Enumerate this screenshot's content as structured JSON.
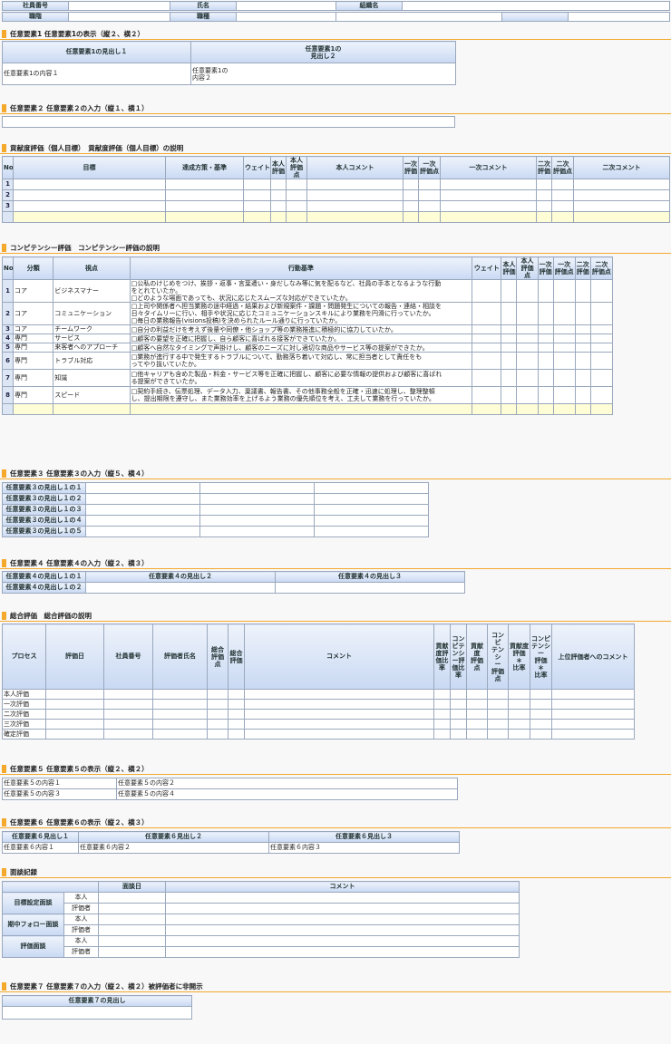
{
  "header": {
    "employee_no_label": "社員番号",
    "name_label": "氏名",
    "org_label": "組織名",
    "grade_label": "職階",
    "job_type_label": "職種"
  },
  "s1": {
    "title": "任意要素1 任意要素1の表示（縦２、横２）",
    "col1": "任意要素1の見出し１",
    "col2": "任意要素1の\n見出し２",
    "cell1": "任意要素1の内容１",
    "cell2": "任意要素1の\n内容２"
  },
  "s2": {
    "title": "任意要素２ 任意要素２の入力（縦１、横１）"
  },
  "s3": {
    "title": "貢献度評価（個人目標）　貢献度評価（個人目標）の説明",
    "headers": [
      "No",
      "目標",
      "達成方策・基準",
      "ウェイト",
      "本人評価",
      "本人評価点",
      "本人コメント",
      "一次評価",
      "一次評価点",
      "一次コメント",
      "二次評価",
      "二次評価点",
      "二次コメント"
    ],
    "rows": [
      "1",
      "2",
      "3"
    ]
  },
  "s4": {
    "title": "コンピテンシー評価　コンピテンシー評価の説明",
    "headers": [
      "No",
      "分類",
      "視点",
      "行動基準",
      "ウェイト",
      "本人評価",
      "本人評価点",
      "一次評価",
      "一次評価点",
      "二次評価",
      "二次評価点"
    ],
    "rows": [
      {
        "no": "1",
        "cat": "コア",
        "view": "ビジネスマナー",
        "lines": [
          "□公私のけじめをつけ、挨拶・返事・言葉遣い・身だしなみ等に気を配るなど、社員の手本となるような行動",
          "をとれていたか。",
          "□どのような場面であっても、状況に応じたスムーズな対応ができていたか。"
        ]
      },
      {
        "no": "2",
        "cat": "コア",
        "view": "コミュニケーション",
        "lines": [
          "□上司や関係者へ担当業務の途中経過・結果および新規案件・課題・問題発生についての報告・連絡・相談を",
          "日々タイムリーに行い、相手や状況に応じたコミュニケーションスキルにより業務を円滑に行っていたか。",
          "□毎日の業務報告(visions投稿)を決められたルール通りに行っていたか。"
        ]
      },
      {
        "no": "3",
        "cat": "コア",
        "view": "チームワーク",
        "lines": [
          "□自分の利益だけを考えず後輩や同僚・他ショップ等の業務推進に積極的に協力していたか。"
        ]
      },
      {
        "no": "4",
        "cat": "専門",
        "view": "サービス",
        "lines": [
          "□顧客の要望を正確に把握し、自ら顧客に喜ばれる接客ができていたか。"
        ]
      },
      {
        "no": "5",
        "cat": "専門",
        "view": "来客者へのアプローチ",
        "lines": [
          "□顧客へ自然なタイミングで声掛けし、顧客のニーズに対し適切な商品やサービス等の提案ができたか。"
        ]
      },
      {
        "no": "6",
        "cat": "専門",
        "view": "トラブル対応",
        "lines": [
          "□業務が進行する中で発生するトラブルについて、勤務落ち着いて対応し、常に担当者として責任をも",
          "ってやり抜いていたか。"
        ]
      },
      {
        "no": "7",
        "cat": "専門",
        "view": "知識",
        "lines": [
          "□他キャリアも含めた製品・料金・サービス等を正確に把握し、顧客に必要な情報の提供および顧客に喜ばれ",
          "る提案ができていたか。"
        ]
      },
      {
        "no": "8",
        "cat": "専門",
        "view": "スピード",
        "lines": [
          "□契約手続き、伝票処理、データ入力、稟議書、報告書、その他事務全般を正確・迅速に処理し、整理整頓",
          "し、提出期限を遵守し、また業務効率を上げるよう業務の優先順位を考え、工夫して業務を行っていたか。"
        ]
      }
    ]
  },
  "s5": {
    "title": "任意要素３ 任意要素３の入力（縦５、横４）",
    "rows": [
      "任意要素３の見出し１の１",
      "任意要素３の見出し１の２",
      "任意要素３の見出し１の３",
      "任意要素３の見出し１の４",
      "任意要素３の見出し１の５"
    ]
  },
  "s6": {
    "title": "任意要素４ 任意要素４の入力（縦２、横３）",
    "col2": "任意要素４の見出し２",
    "col3": "任意要素４の見出し３",
    "rows": [
      "任意要素４の見出し１の１",
      "任意要素４の見出し１の２"
    ]
  },
  "s7": {
    "title": "総合評価　総合評価の説明",
    "headers": [
      "プロセス",
      "評価日",
      "社員番号",
      "評価者氏名",
      "総合評価点",
      "総合評価",
      "コメント",
      "貢献度評価比率",
      "コンピテンシー評価比率",
      "貢献度評価点",
      "コンピテンシー評価点",
      "貢献度評価＊比率",
      "コンピテンシー評価＊比率",
      "上位評価者へのコメント"
    ],
    "rows": [
      "本人評価",
      "一次評価",
      "二次評価",
      "三次評価",
      "確定評価"
    ]
  },
  "s8": {
    "title": "任意要素５ 任意要素５の表示（縦２、横２）",
    "cells": [
      [
        "任意要素５の内容１",
        "任意要素５の内容２"
      ],
      [
        "任意要素５の内容３",
        "任意要素５の内容４"
      ]
    ]
  },
  "s9": {
    "title": "任意要素６ 任意要素６の表示（縦２、横３）",
    "headers": [
      "任意要素６見出し１",
      "任意要素６見出し２",
      "任意要素６見出し３"
    ],
    "cells": [
      "任意要素６内容１",
      "任意要素６内容２",
      "任意要素６内容３"
    ]
  },
  "s10": {
    "title": "面談記録",
    "headers": [
      "面談日",
      "コメント"
    ],
    "groups": [
      "目標設定面談",
      "期中フォロー面談",
      "評価面談"
    ],
    "roles": [
      "本人",
      "評価者"
    ]
  },
  "s11": {
    "title": "任意要素７ 任意要素７の入力（縦２、横２）被評価者に非開示",
    "header": "任意要素７の見出し"
  }
}
